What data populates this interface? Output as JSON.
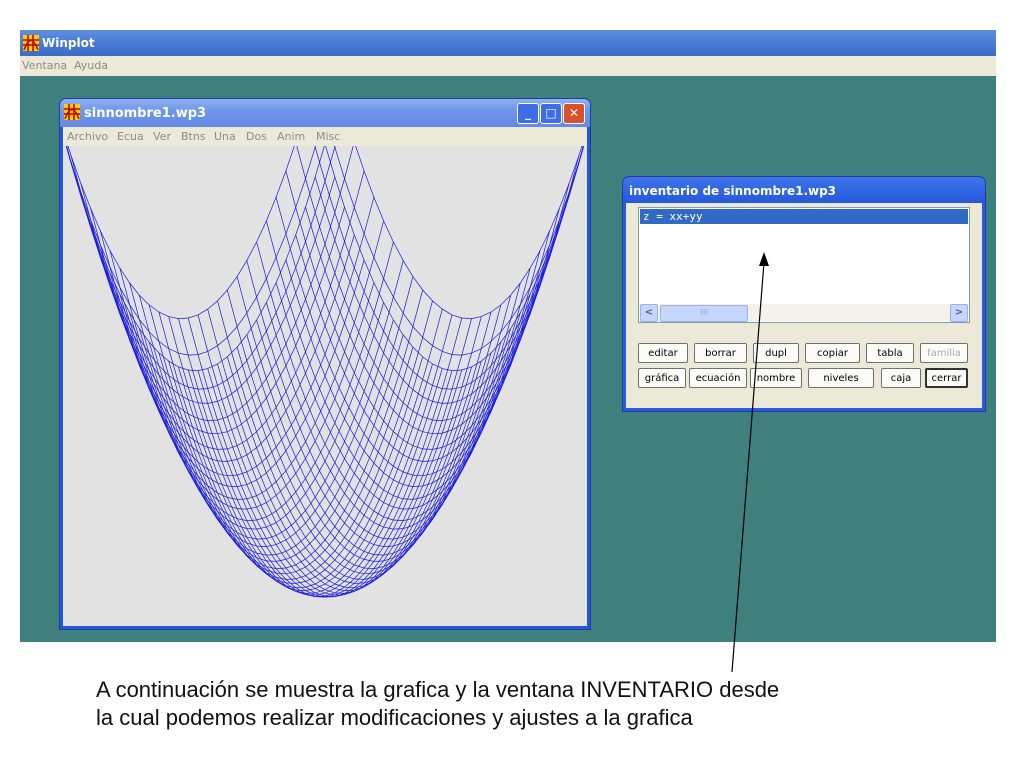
{
  "app": {
    "title": "Winplot",
    "menu": [
      "Ventana",
      "Ayuda"
    ],
    "icon": "winplot-grid-icon"
  },
  "graph_window": {
    "title": "sinnombre1.wp3",
    "menu": [
      "Archivo",
      "Ecua",
      "Ver",
      "Btns",
      "Una",
      "Dos",
      "Anim",
      "Misc"
    ],
    "buttons": {
      "minimize": "_",
      "maximize": "□",
      "close": "✕"
    },
    "plot": {
      "equation": "z = xx+yy",
      "color": "#1a1ae0",
      "surface": "paraboloid wireframe"
    }
  },
  "inventory": {
    "title": "inventario de sinnombre1.wp3",
    "items": [
      "z = xx+yy"
    ],
    "scroll_left": "<",
    "scroll_right": ">",
    "scroll_thumb": "III",
    "buttons_row1": [
      "editar",
      "borrar",
      "dupl",
      "copiar",
      "tabla",
      "familia"
    ],
    "buttons_row2": [
      "gráfica",
      "ecuación",
      "nombre",
      "niveles",
      "caja",
      "cerrar"
    ]
  },
  "caption": {
    "line1": "A continuación se muestra la grafica y la ventana INVENTARIO desde",
    "line2": "la cual podemos realizar modificaciones y ajustes a la grafica"
  },
  "colors": {
    "desktop": "#3f7f7d",
    "titlebar": "#4b7cd6",
    "plot": "#1a1ae0"
  }
}
